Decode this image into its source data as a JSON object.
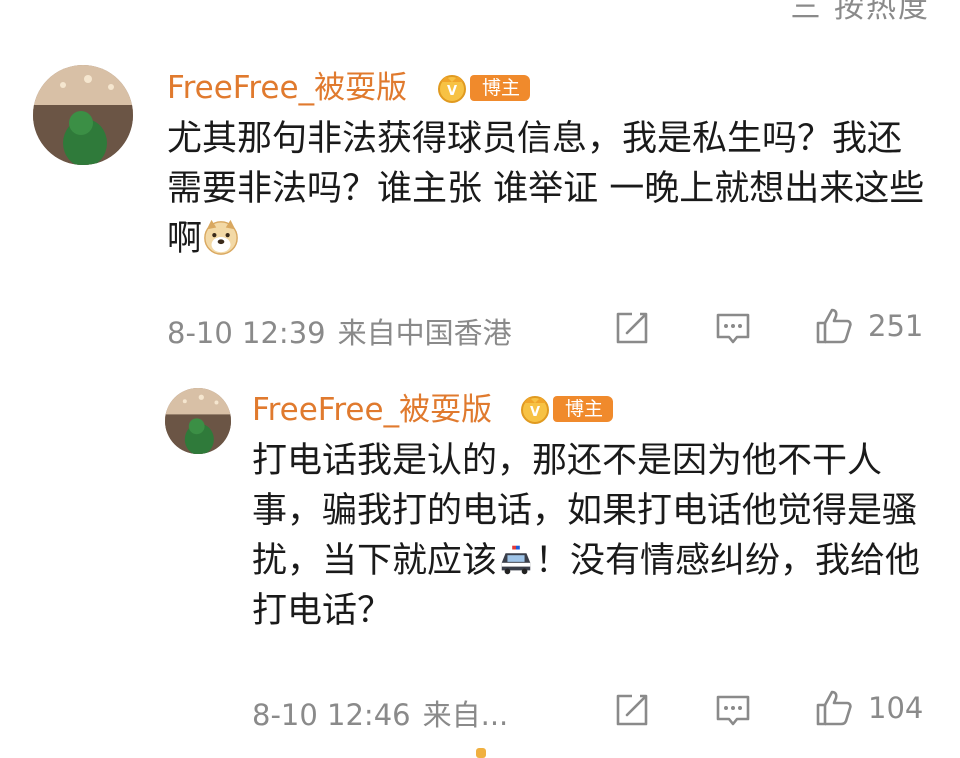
{
  "header": {
    "sort_hint": "三 按热度"
  },
  "comment": {
    "username": "FreeFree_被耍版",
    "badge": "博主",
    "text_before_emoji": "尤其那句非法获得球员信息，我是私生吗？我还需要非法吗？谁主张 谁举证 一晚上就想出来这些啊",
    "emoji": "doge-emoji",
    "timestamp": "8-10 12:39",
    "location": "来自中国香港",
    "likes": "251"
  },
  "reply": {
    "username": "FreeFree_被耍版",
    "badge": "博主",
    "text_before_emoji": "打电话我是认的，那还不是因为他不干人事，骗我打的电话，如果打电话他觉得是骚扰，当下就应该",
    "emoji": "police-car-emoji",
    "text_after_emoji": "！没有情感纠纷，我给他打电话？",
    "timestamp": "8-10 12:46",
    "location": "来自...",
    "likes": "104"
  },
  "icons": {
    "share": "share-icon",
    "comment": "comment-icon",
    "like": "thumbs-up-icon",
    "crown": "crown-badge-icon"
  },
  "colors": {
    "username": "#e07a2e",
    "badge": "#f08a2c",
    "meta": "#8a8a8a",
    "text": "#1a1a1a"
  }
}
